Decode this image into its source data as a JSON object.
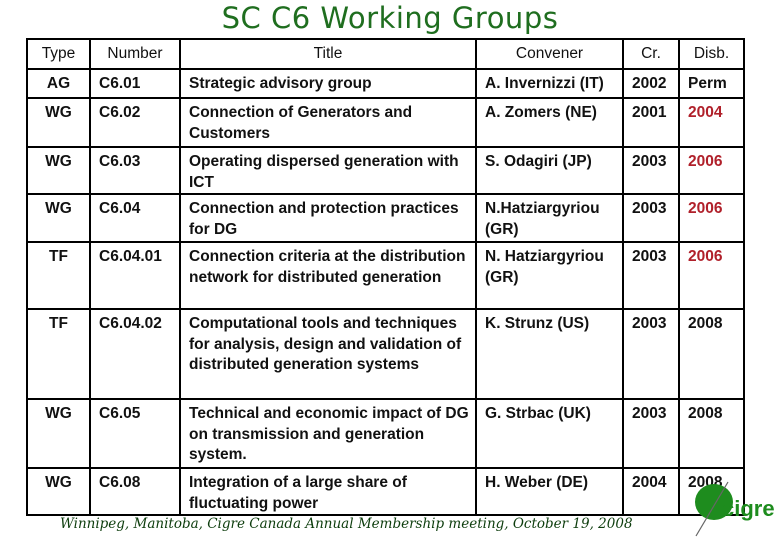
{
  "slide": {
    "title": "SC C6 Working Groups",
    "footer": "Winnipeg, Manitoba, Cigre Canada Annual Membership meeting, October 19, 2008",
    "logo_text": "cigre",
    "colors": {
      "title": "#1f6e1f",
      "highlight_red": "#b0202a",
      "logo_green": "#1e8c1e"
    }
  },
  "table": {
    "headers": [
      "Type",
      "Number",
      "Title",
      "Convener",
      "Cr.",
      "Disb."
    ],
    "rows": [
      {
        "type": "AG",
        "number": "C6.01",
        "title": "Strategic advisory group",
        "convener": "A. Invernizzi (IT)",
        "cr": "2002",
        "disb": "Perm",
        "disb_red": false
      },
      {
        "type": "WG",
        "number": "C6.02",
        "title": "Connection of Generators and Customers",
        "convener": "A. Zomers (NE)",
        "cr": "2001",
        "disb": "2004",
        "disb_red": true
      },
      {
        "type": "WG",
        "number": "C6.03",
        "title": "Operating dispersed generation with ICT",
        "convener": "S. Odagiri (JP)",
        "cr": "2003",
        "disb": "2006",
        "disb_red": true
      },
      {
        "type": "WG",
        "number": "C6.04",
        "title": "Connection and protection practices for DG",
        "convener": "N.Hatziargyriou (GR)",
        "cr": "2003",
        "disb": "2006",
        "disb_red": true
      },
      {
        "type": "TF",
        "number": "C6.04.01",
        "title": "Connection criteria at the distribution network for distributed generation",
        "convener": "N. Hatziargyriou (GR)",
        "cr": "2003",
        "disb": "2006",
        "disb_red": true
      },
      {
        "type": "TF",
        "number": "C6.04.02",
        "title": "Computational tools and techniques for analysis, design and validation of distributed generation systems",
        "convener": "K. Strunz (US)",
        "cr": "2003",
        "disb": "2008",
        "disb_red": false
      },
      {
        "type": "WG",
        "number": "C6.05",
        "title": "Technical and economic impact of DG on transmission and generation system.",
        "convener": "G. Strbac (UK)",
        "cr": "2003",
        "disb": "2008",
        "disb_red": false
      },
      {
        "type": "WG",
        "number": "C6.08",
        "title": "Integration of a large share of fluctuating power",
        "convener": "H. Weber (DE)",
        "cr": "2004",
        "disb": "2008",
        "disb_red": false
      }
    ]
  }
}
